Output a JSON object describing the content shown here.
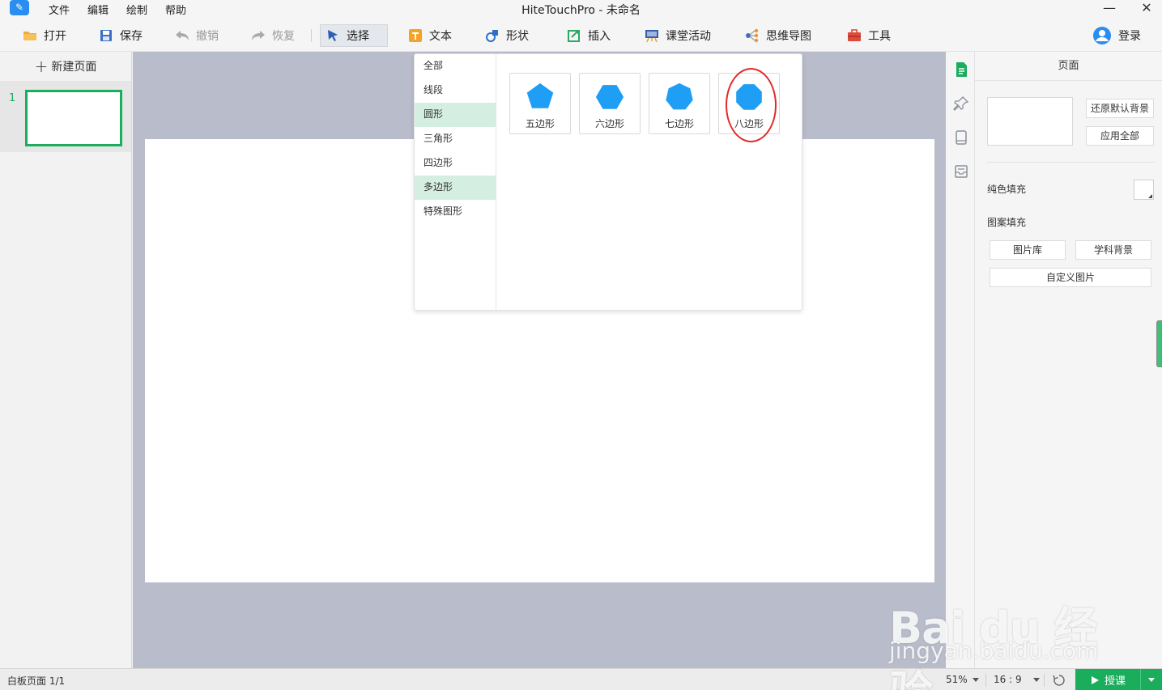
{
  "window": {
    "title": "HiteTouchPro - 未命名",
    "minimize": "—",
    "close": "✕"
  },
  "menu": [
    "文件",
    "编辑",
    "绘制",
    "帮助"
  ],
  "toolbar": {
    "open": "打开",
    "save": "保存",
    "undo": "撤销",
    "redo": "恢复",
    "select": "选择",
    "text": "文本",
    "shape": "形状",
    "insert": "插入",
    "activity": "课堂活动",
    "mindmap": "思维导图",
    "tools": "工具",
    "login": "登录"
  },
  "pages_panel": {
    "new_page": "新建页面",
    "pages": [
      {
        "number": "1"
      }
    ]
  },
  "shape_picker": {
    "categories": [
      "全部",
      "线段",
      "圆形",
      "三角形",
      "四边形",
      "多边形",
      "特殊图形"
    ],
    "selected_category": "多边形",
    "shapes": [
      {
        "label": "五边形",
        "sides": 5
      },
      {
        "label": "六边形",
        "sides": 6
      },
      {
        "label": "七边形",
        "sides": 7
      },
      {
        "label": "八边形",
        "sides": 8
      }
    ],
    "shape_color": "#1e9ef4",
    "highlighted_shape": "八边形"
  },
  "properties": {
    "title": "页面",
    "reset_bg": "还原默认背景",
    "apply_all": "应用全部",
    "solid_fill": "纯色填充",
    "pattern_fill": "图案填充",
    "gallery": "图片库",
    "subject_bg": "学科背景",
    "custom_image": "自定义图片"
  },
  "status": {
    "page_info": "白板页面 1/1",
    "zoom": "51%",
    "ratio": "16 : 9",
    "teach": "授课"
  },
  "watermark": {
    "main": "Bai du 经验",
    "sub": "jingyan.baidu.com"
  },
  "colors": {
    "accent": "#1aad5c",
    "canvas_bg": "#b8bccb",
    "annotation": "#e12a2a"
  }
}
